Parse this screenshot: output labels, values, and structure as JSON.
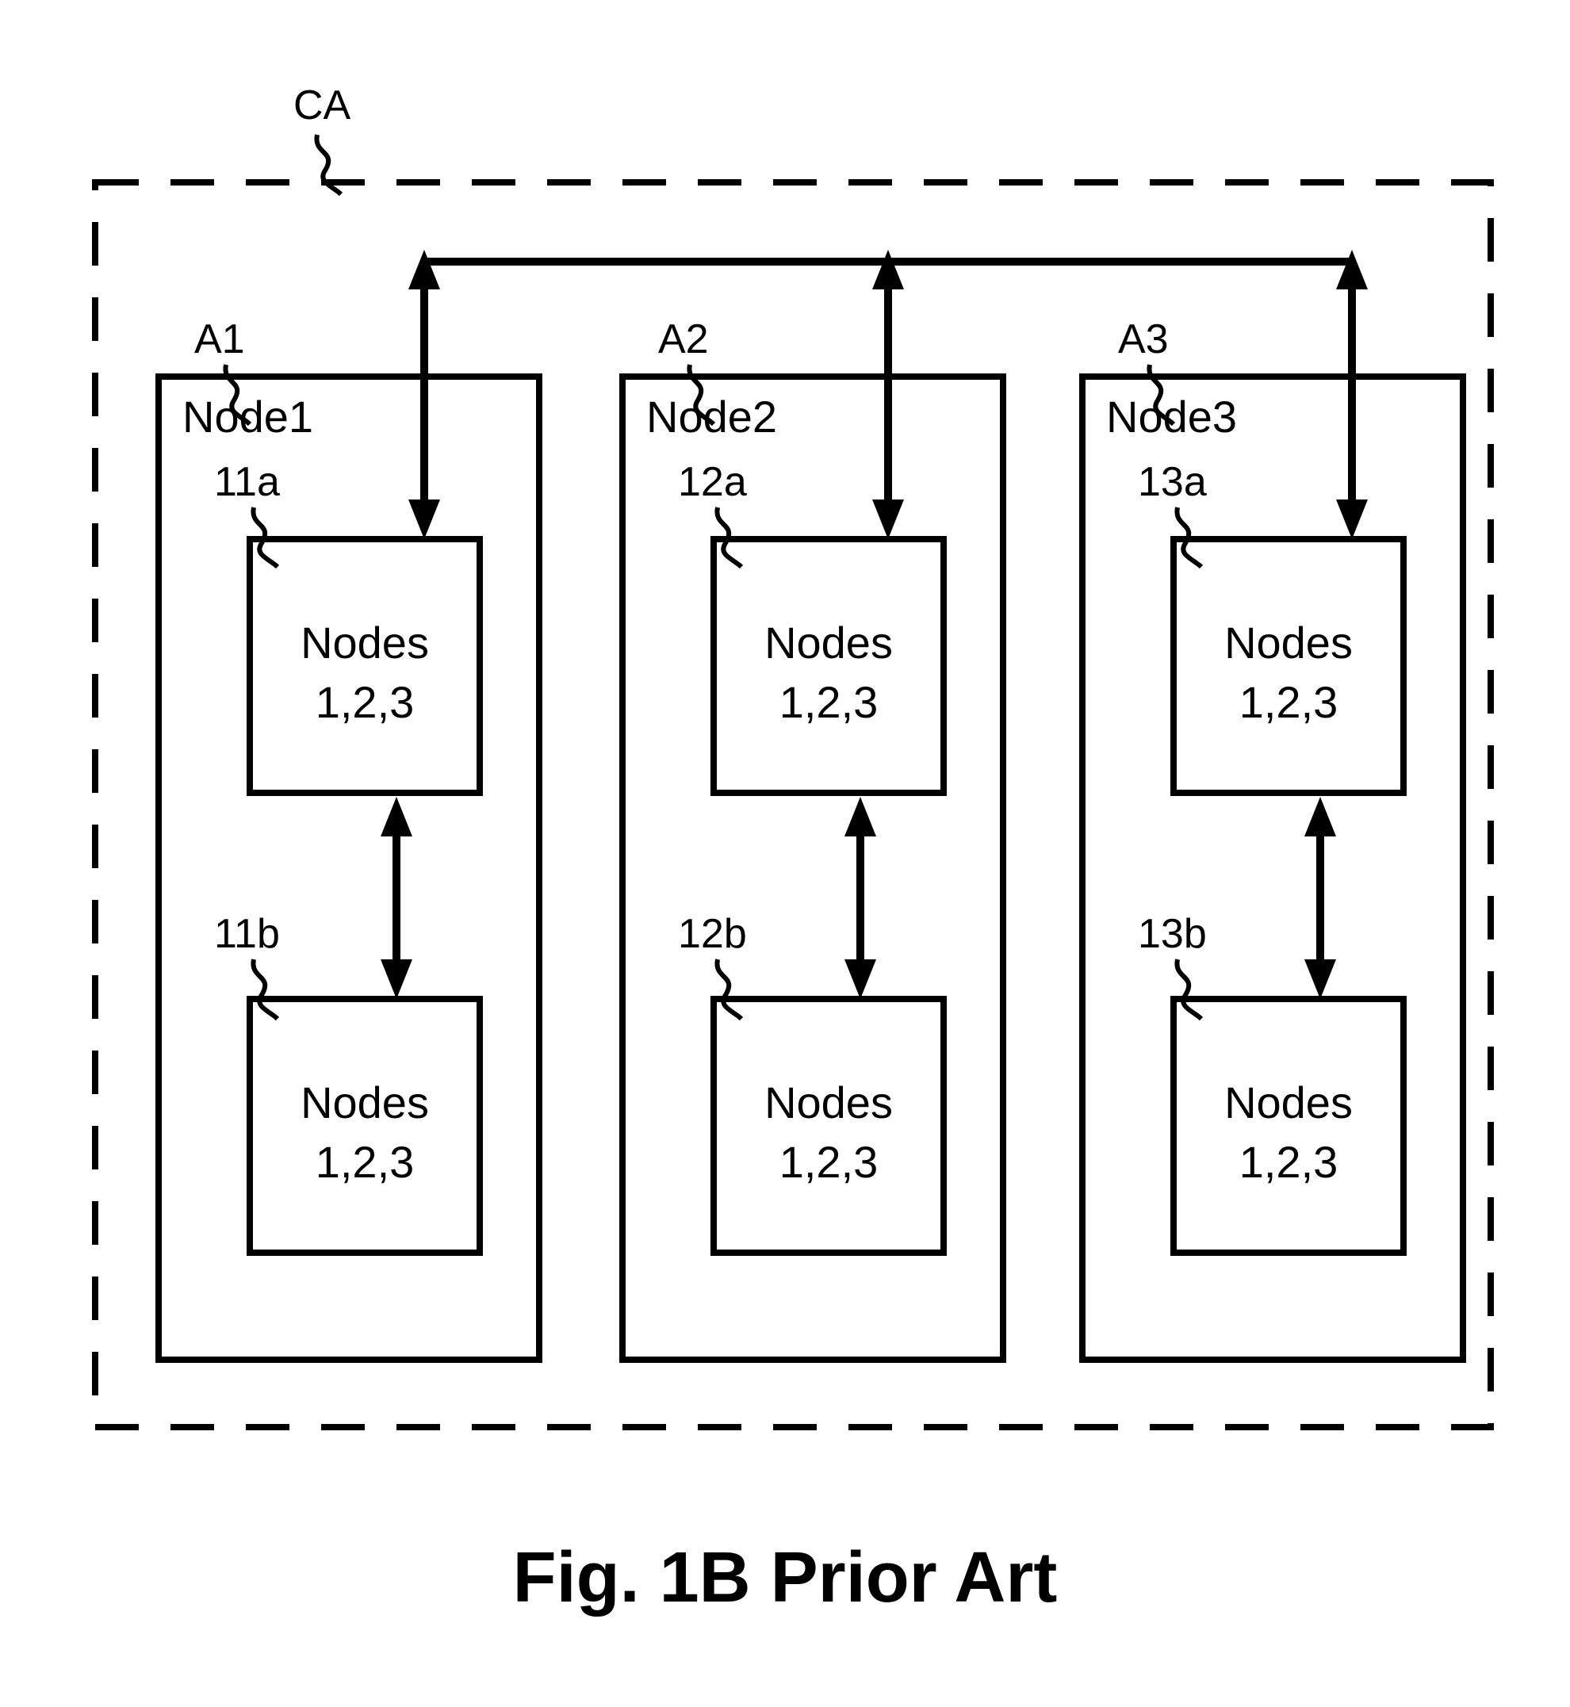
{
  "labels": {
    "ca": "CA",
    "a1": "A1",
    "a2": "A2",
    "a3": "A3",
    "node1": "Node1",
    "node2": "Node2",
    "node3": "Node3",
    "ref11a": "11a",
    "ref11b": "11b",
    "ref12a": "12a",
    "ref12b": "12b",
    "ref13a": "13a",
    "ref13b": "13b",
    "inner_line1": "Nodes",
    "inner_line2": "1,2,3"
  },
  "caption": "Fig. 1B   Prior Art",
  "diagram": {
    "description": "Cluster CA containing three nodes (Node1, Node2, Node3) labeled A1, A2, A3. Each node holds two inner blocks (11a/11b, 12a/12b, 13a/13b) each containing the text 'Nodes 1,2,3'. A horizontal bus with double-headed vertical arrows connects the three nodes. Each inner pair is connected by a vertical double-headed arrow.",
    "outer_box": "CA",
    "nodes": [
      {
        "id": "A1",
        "title": "Node1",
        "inner": [
          {
            "ref": "11a",
            "text": [
              "Nodes",
              "1,2,3"
            ]
          },
          {
            "ref": "11b",
            "text": [
              "Nodes",
              "1,2,3"
            ]
          }
        ]
      },
      {
        "id": "A2",
        "title": "Node2",
        "inner": [
          {
            "ref": "12a",
            "text": [
              "Nodes",
              "1,2,3"
            ]
          },
          {
            "ref": "12b",
            "text": [
              "Nodes",
              "1,2,3"
            ]
          }
        ]
      },
      {
        "id": "A3",
        "title": "Node3",
        "inner": [
          {
            "ref": "13a",
            "text": [
              "Nodes",
              "1,2,3"
            ]
          },
          {
            "ref": "13b",
            "text": [
              "Nodes",
              "1,2,3"
            ]
          }
        ]
      }
    ]
  }
}
